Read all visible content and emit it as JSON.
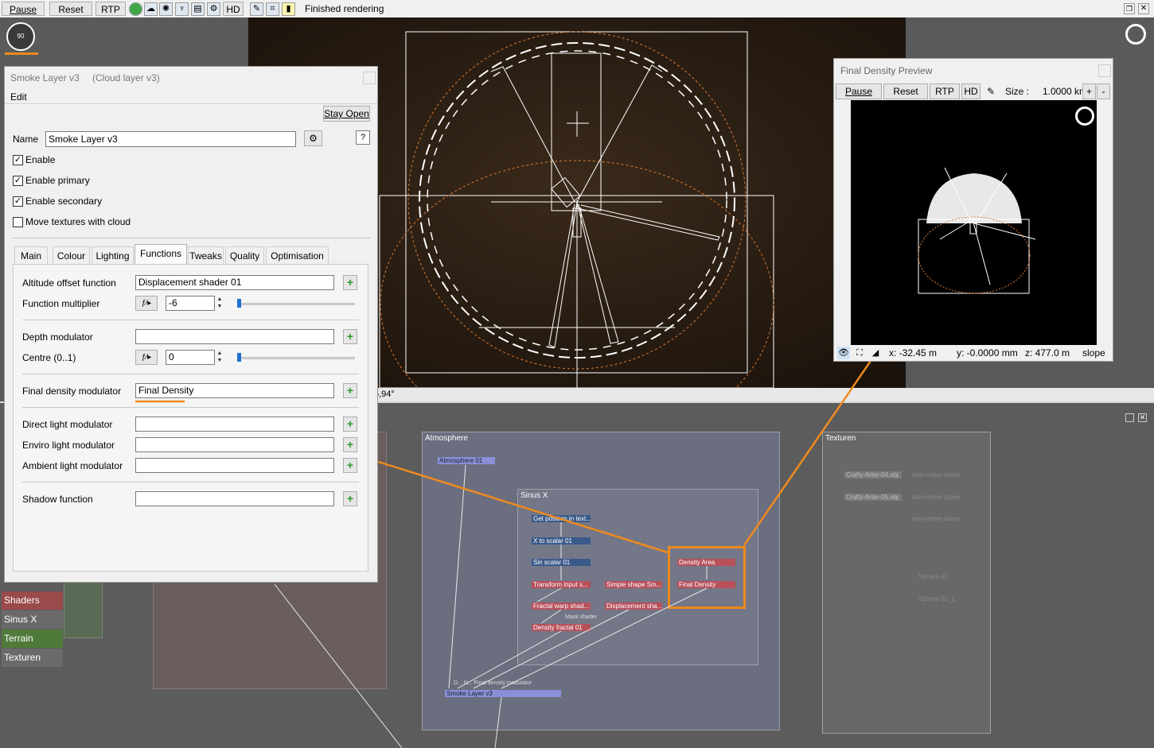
{
  "toolbar": {
    "pause": "Pause",
    "reset": "Reset",
    "rtp": "RTP",
    "hd": "HD",
    "status": "Finished rendering",
    "icons": [
      "sphere-icon",
      "cloud-icon",
      "sun-icon",
      "light-icon",
      "layers-icon",
      "settings-icon",
      "brush-icon",
      "crop-icon",
      "bar-icon"
    ]
  },
  "viewport": {
    "coord_text": "5,94°"
  },
  "compass_label": "90",
  "dialog": {
    "title": "Smoke Layer v3",
    "subtitle": "(Cloud layer v3)",
    "menu_edit": "Edit",
    "stay_open": "Stay Open",
    "name_label": "Name",
    "name_value": "Smoke Layer v3",
    "help": "?",
    "checkboxes": [
      {
        "label": "Enable",
        "checked": true
      },
      {
        "label": "Enable primary",
        "checked": true
      },
      {
        "label": "Enable secondary",
        "checked": true
      },
      {
        "label": "Move textures with cloud",
        "checked": false
      }
    ],
    "tabs": [
      "Main",
      "Colour",
      "Lighting",
      "Functions",
      "Tweaks",
      "Quality",
      "Optimisation"
    ],
    "active_tab": "Functions",
    "functions": {
      "altitude_label": "Altitude offset function",
      "altitude_value": "Displacement shader 01",
      "multiplier_label": "Function multiplier",
      "multiplier_value": "-6",
      "depth_label": "Depth modulator",
      "depth_value": "",
      "centre_label": "Centre (0..1)",
      "centre_value": "0",
      "final_density_label": "Final density modulator",
      "final_density_value": "Final Density",
      "direct_label": "Direct light modulator",
      "enviro_label": "Enviro light modulator",
      "ambient_label": "Ambient light modulator",
      "shadow_label": "Shadow function"
    }
  },
  "preview": {
    "title": "Final Density Preview",
    "pause": "Pause",
    "reset": "Reset",
    "rtp": "RTP",
    "hd": "HD",
    "size_label": "Size :",
    "size_value": "1.0000 km",
    "plus": "+",
    "minus": "-",
    "x": "x: -32.45 m",
    "y": "y: -0.0000 mm",
    "z": "z: 477.0 m",
    "slope": "slope"
  },
  "graph": {
    "side_tabs": [
      "Shaders",
      "Sinus X",
      "Terrain",
      "Texturen"
    ],
    "side_tab_colors": [
      "#9a4a4a",
      "#6a6a6a",
      "#4f7a3a",
      "#6a6a6a"
    ],
    "atmosphere": {
      "title": "Atmosphere",
      "atmo_node": "Atmosphere 01",
      "smoke_node": "Smoke Layer v3",
      "smoke_inputs": "D... N...   Final density modulator"
    },
    "sinus": {
      "title": "Sinus X",
      "nodes": [
        "Get position in text...",
        "X to scalar 01",
        "Sin scalar 01",
        "Transform input s...",
        "Simple shape Sm...",
        "Fractal warp shad...",
        "Displacement sha...",
        "Density fractal 01"
      ],
      "mask_label": "Mask shader",
      "density_area": "Density Area",
      "final_density": "Final Density"
    },
    "texturen": {
      "title": "Texturen",
      "nodes": [
        "Crafty-Arter-04.obj",
        "Crafty-Arter-05.obj",
        "zwei-meter-plane",
        "zwei-meter-plane",
        "zwei-meter-plane",
        "Sphere 01",
        "Sphere 01_1"
      ]
    },
    "highlight_color": "#ef8a1e"
  }
}
